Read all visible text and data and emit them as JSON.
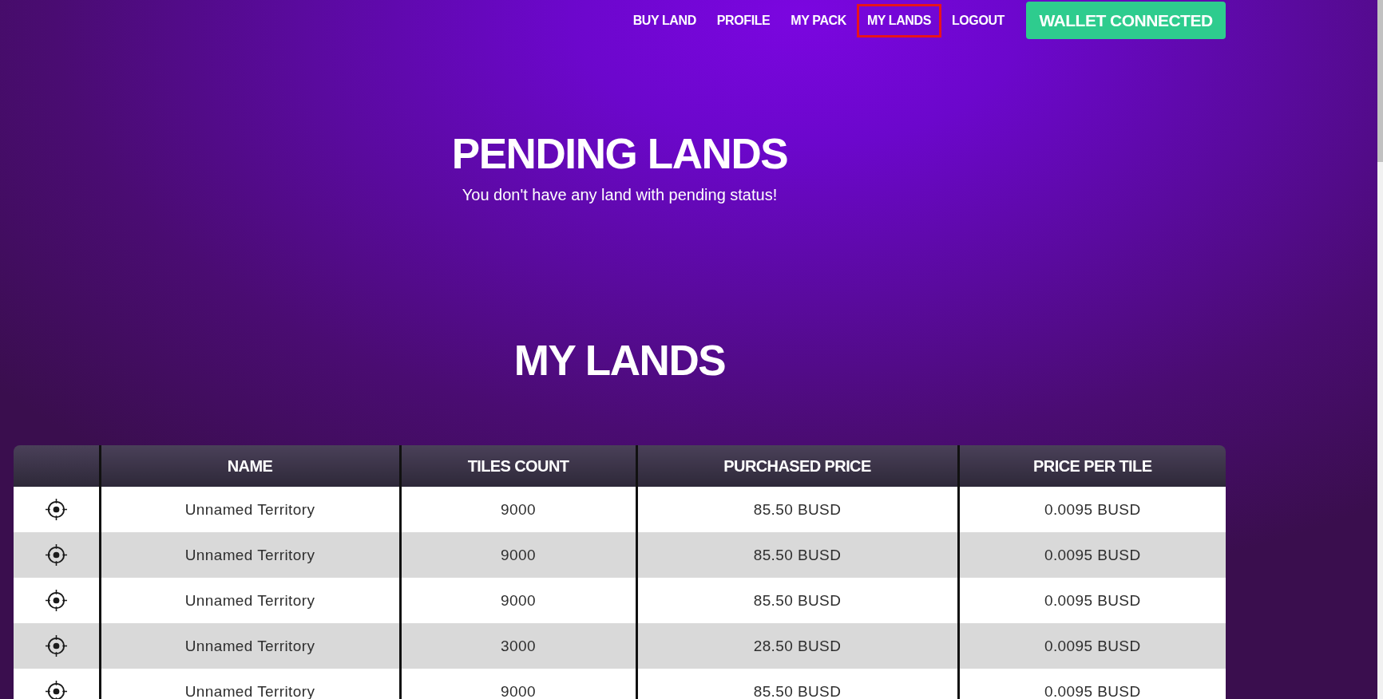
{
  "nav": {
    "items": [
      {
        "label": "BUY LAND",
        "selected": false
      },
      {
        "label": "PROFILE",
        "selected": false
      },
      {
        "label": "MY PACK",
        "selected": false
      },
      {
        "label": "MY LANDS",
        "selected": true
      },
      {
        "label": "LOGOUT",
        "selected": false
      }
    ],
    "wallet_button": "WALLET CONNECTED"
  },
  "pending": {
    "title": "PENDING LANDS",
    "message": "You don't have any land with pending status!"
  },
  "lands": {
    "title": "MY LANDS",
    "table": {
      "columns": [
        "NAME",
        "TILES COUNT",
        "PURCHASED PRICE",
        "PRICE PER TILE"
      ],
      "rows": [
        {
          "name": "Unnamed Territory",
          "tiles_count": "9000",
          "purchased_price": "85.50 BUSD",
          "price_per_tile": "0.0095 BUSD"
        },
        {
          "name": "Unnamed Territory",
          "tiles_count": "9000",
          "purchased_price": "85.50 BUSD",
          "price_per_tile": "0.0095 BUSD"
        },
        {
          "name": "Unnamed Territory",
          "tiles_count": "9000",
          "purchased_price": "85.50 BUSD",
          "price_per_tile": "0.0095 BUSD"
        },
        {
          "name": "Unnamed Territory",
          "tiles_count": "3000",
          "purchased_price": "28.50 BUSD",
          "price_per_tile": "0.0095 BUSD"
        },
        {
          "name": "Unnamed Territory",
          "tiles_count": "9000",
          "purchased_price": "85.50 BUSD",
          "price_per_tile": "0.0095 BUSD"
        }
      ]
    }
  }
}
